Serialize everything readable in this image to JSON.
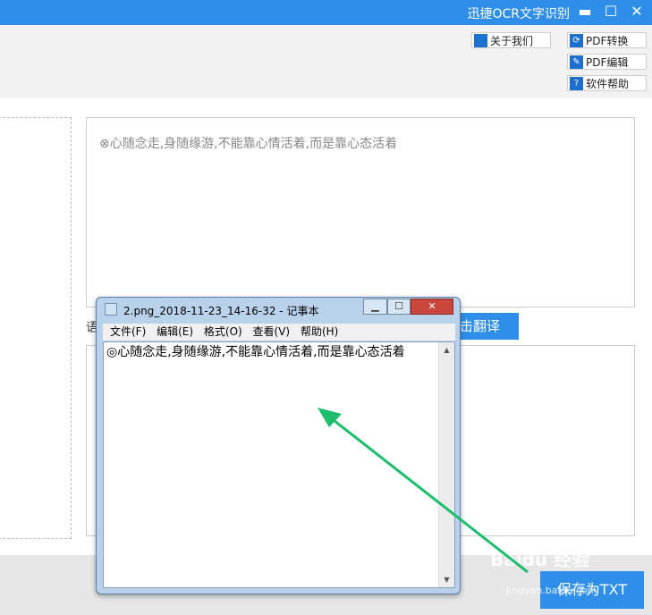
{
  "app": {
    "title": "迅捷OCR文字识别",
    "minimize_glyph": "▬",
    "maximize_glyph": "☐",
    "close_glyph": "✕"
  },
  "toolbar": {
    "about_label": "关于我们",
    "pdf_convert_label": "PDF转换",
    "pdf_edit_label": "PDF编辑",
    "help_label": "软件帮助"
  },
  "result": {
    "text": "⊗心随念走,身随缘游,不能靠心情活着,而是靠心态活着"
  },
  "translate": {
    "language_label": "语",
    "button_label": "击翻译"
  },
  "bottom": {
    "save_label": "保存为TXT"
  },
  "watermark": {
    "brand": "Baidu 经验",
    "url": "jingyan.baidu.com"
  },
  "notepad": {
    "title": "2.png_2018-11-23_14-16-32 - 记事本",
    "menus": [
      "文件(F)",
      "编辑(E)",
      "格式(O)",
      "查看(V)",
      "帮助(H)"
    ],
    "content": "◎心随念走,身随缘游,不能靠心情活着,而是靠心态活着"
  },
  "colors": {
    "accent": "#2f8fe8",
    "arrow": "#1dbd6e"
  }
}
